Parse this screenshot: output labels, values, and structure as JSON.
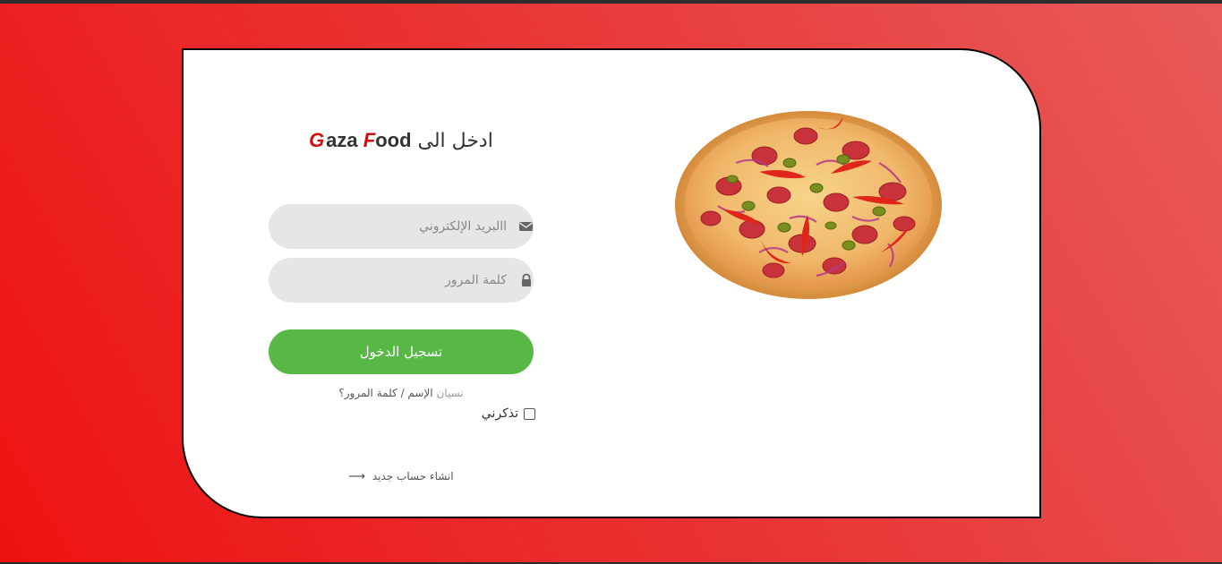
{
  "login": {
    "title_text": "ادخل الى",
    "brand_g": "G",
    "brand_aza": "aza",
    "brand_f": "F",
    "brand_ood": "ood",
    "email_placeholder": "االبريد الإلكتروني",
    "password_placeholder": "كلمة المرور",
    "login_button": "تسجيل الدخول",
    "forgot_prefix": "نسيان",
    "forgot_link": "الإسم / كلمة المرور؟",
    "remember_label": "تذكرني",
    "remember_checked": false,
    "signup_link": "انشاء حساب جديد"
  },
  "icons": {
    "email": "envelope-icon",
    "password": "lock-icon",
    "signup_arrow": "long-arrow-right-icon",
    "image": "pizza-image"
  },
  "colors": {
    "background_gradient": [
      "#ee1212",
      "#e85a5a"
    ],
    "brand_accent": "#d10f0f",
    "login_button": "#57b846",
    "field_background": "#e6e6e6"
  }
}
